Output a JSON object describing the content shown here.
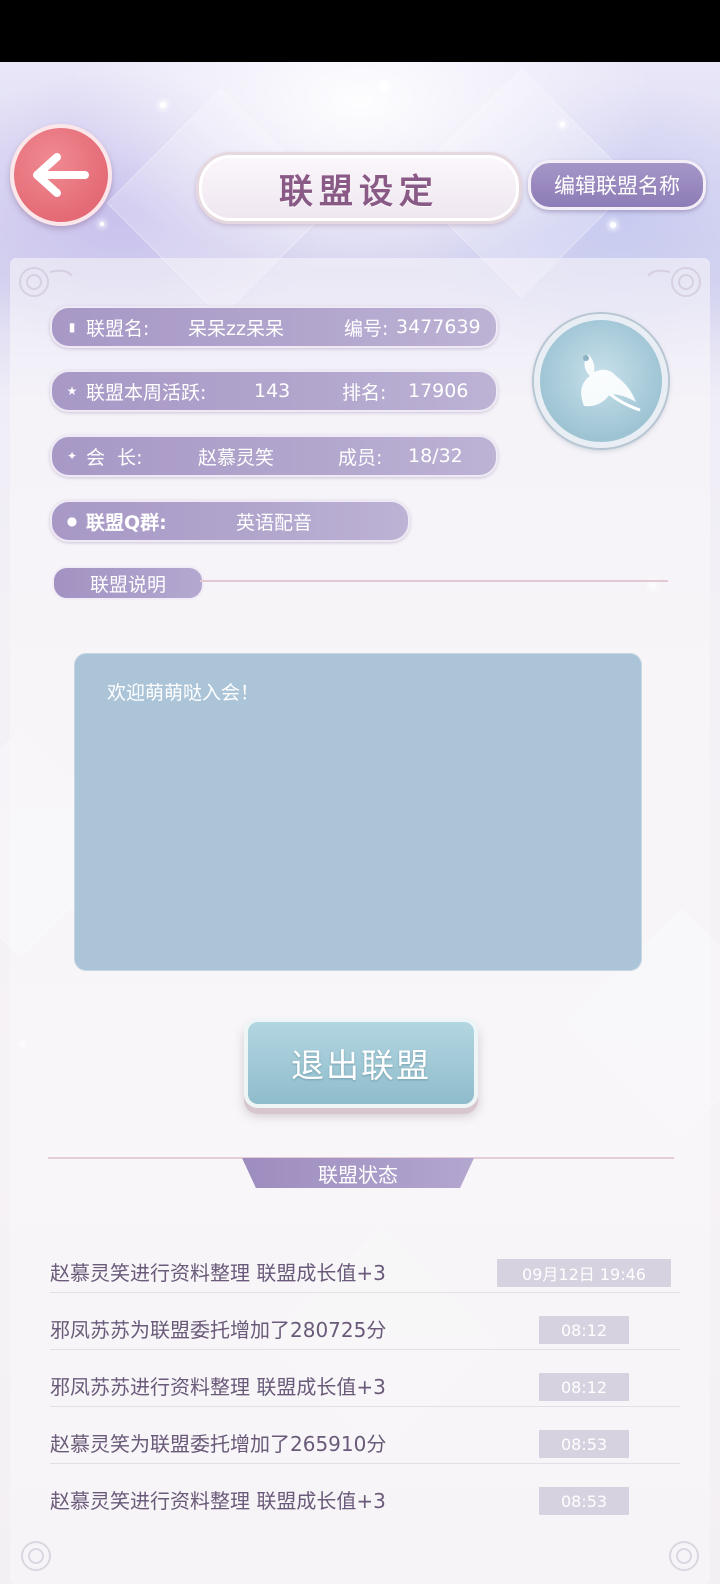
{
  "header": {
    "title": "联盟设定",
    "edit_name_label": "编辑联盟名称"
  },
  "info": {
    "name_label": "联盟名:",
    "name_value": "呆呆zz呆呆",
    "id_label": "编号:",
    "id_value": "3477639",
    "activity_label": "联盟本周活跃:",
    "activity_value": "143",
    "rank_label": "排名:",
    "rank_value": "17906",
    "leader_label": "会  长:",
    "leader_value": "赵慕灵笑",
    "members_label": "成员:",
    "members_value": "18/32",
    "qq_label": "联盟Q群:",
    "qq_value": "英语配音"
  },
  "description": {
    "section_label": "联盟说明",
    "text": "欢迎萌萌哒入会！"
  },
  "quit_label": "退出联盟",
  "status": {
    "section_label": "联盟状态",
    "logs": [
      {
        "text": "赵慕灵笑进行资料整理 联盟成长值+3",
        "time": "09月12日 19:46"
      },
      {
        "text": "邪凤苏苏为联盟委托增加了280725分",
        "time": "08:12"
      },
      {
        "text": "邪凤苏苏进行资料整理 联盟成长值+3",
        "time": "08:12"
      },
      {
        "text": "赵慕灵笑为联盟委托增加了265910分",
        "time": "08:53"
      },
      {
        "text": "赵慕灵笑进行资料整理 联盟成长值+3",
        "time": "08:53"
      }
    ]
  },
  "icons": {
    "back": "back-arrow-icon",
    "emblem": "phoenix-emblem-icon"
  },
  "colors": {
    "accent_purple": "#a596c7",
    "back_red": "#e46b76",
    "desc_blue": "#abc4d8",
    "quit_teal": "#8fbccb"
  }
}
